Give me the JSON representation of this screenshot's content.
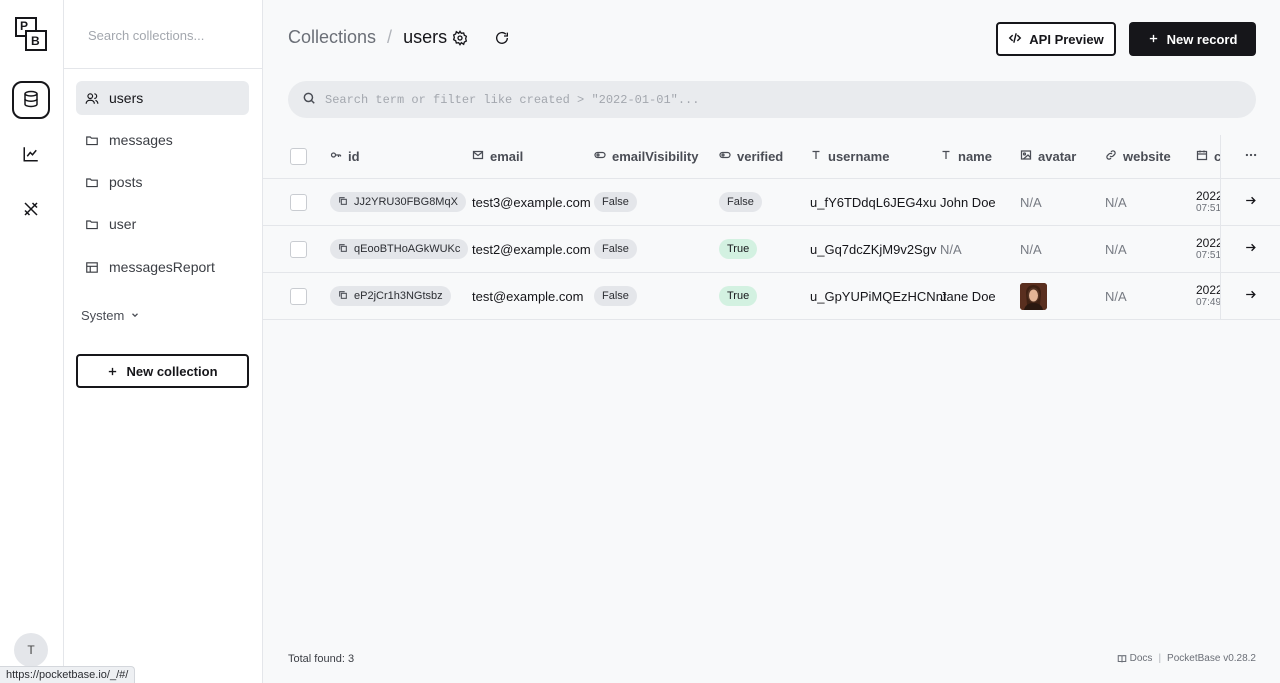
{
  "app": {
    "avatar_initial": "T",
    "status_url": "https://pocketbase.io/_/#/"
  },
  "sidebar": {
    "search_placeholder": "Search collections...",
    "items": [
      {
        "label": "users",
        "icon": "users-icon",
        "active": true
      },
      {
        "label": "messages",
        "icon": "folder-icon"
      },
      {
        "label": "posts",
        "icon": "folder-icon"
      },
      {
        "label": "user",
        "icon": "folder-icon"
      },
      {
        "label": "messagesReport",
        "icon": "table-icon"
      }
    ],
    "system_label": "System",
    "new_collection_label": "New collection"
  },
  "header": {
    "breadcrumb_root": "Collections",
    "breadcrumb_sep": "/",
    "breadcrumb_current": "users",
    "api_preview_label": "API Preview",
    "new_record_label": "New record"
  },
  "search": {
    "placeholder": "Search term or filter like created > \"2022-01-01\"..."
  },
  "table": {
    "columns": [
      {
        "label": "id",
        "icon": "key-icon"
      },
      {
        "label": "email",
        "icon": "mail-icon"
      },
      {
        "label": "emailVisibility",
        "icon": "toggle-icon"
      },
      {
        "label": "verified",
        "icon": "toggle-icon"
      },
      {
        "label": "username",
        "icon": "text-icon"
      },
      {
        "label": "name",
        "icon": "text-icon"
      },
      {
        "label": "avatar",
        "icon": "image-icon"
      },
      {
        "label": "website",
        "icon": "link-icon"
      },
      {
        "label": "created",
        "icon": "calendar-icon"
      }
    ],
    "rows": [
      {
        "id": "JJ2YRU30FBG8MqX",
        "email": "test3@example.com",
        "emailVisibility": "False",
        "verified": "False",
        "username": "u_fY6TDdqL6JEG4xu",
        "name": "John Doe",
        "avatar": "N/A",
        "website": "N/A",
        "created_date": "2022",
        "created_time": "07:51"
      },
      {
        "id": "qEooBTHoAGkWUKc",
        "email": "test2@example.com",
        "emailVisibility": "False",
        "verified": "True",
        "username": "u_Gq7dcZKjM9v2Sgv",
        "name": "N/A",
        "avatar": "N/A",
        "website": "N/A",
        "created_date": "2022",
        "created_time": "07:51"
      },
      {
        "id": "eP2jCr1h3NGtsbz",
        "email": "test@example.com",
        "emailVisibility": "False",
        "verified": "True",
        "username": "u_GpYUPiMQEzHCNnt",
        "name": "Jane Doe",
        "avatar": "",
        "website": "N/A",
        "created_date": "2022",
        "created_time": "07:49"
      }
    ]
  },
  "footer": {
    "total_label": "Total found:",
    "total_count": "3",
    "docs_label": "Docs",
    "sep": "|",
    "version": "PocketBase v0.28.2"
  },
  "colors": {
    "accent_dark": "#16161a",
    "true_badge": "#d3f1e1",
    "false_badge": "#e4e6ea"
  }
}
